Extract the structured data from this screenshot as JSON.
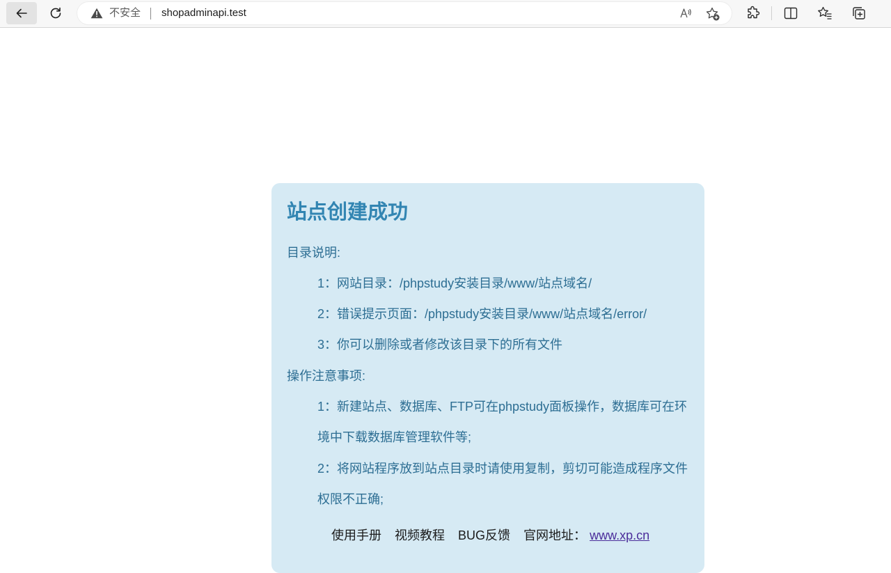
{
  "browser": {
    "insecure_label": "不安全",
    "url": "shopadminapi.test",
    "read_aloud_glyph": "A⁾"
  },
  "content": {
    "title": "站点创建成功",
    "dir_heading": "目录说明:",
    "dir_items": [
      "1：网站目录：/phpstudy安装目录/www/站点域名/",
      "2：错误提示页面：/phpstudy安装目录/www/站点域名/error/",
      "3：你可以删除或者修改该目录下的所有文件"
    ],
    "ops_heading": "操作注意事项:",
    "ops_items": [
      [
        "1：新建站点、数据库、FTP可在phpstudy面板操作，数据库可在环",
        "境中下载数据库管理软件等;"
      ],
      [
        "2：将网站程序放到站点目录时请使用复制，剪切可能造成程序文件",
        "权限不正确;"
      ]
    ],
    "footer": {
      "manual": "使用手册",
      "video": "视频教程",
      "bug": "BUG反馈",
      "site_label": "官网地址：",
      "site_link": "www.xp.cn"
    }
  },
  "colors": {
    "box_bg": "#d6eaf4",
    "title": "#3285b2",
    "text": "#2d6e93",
    "link": "#4b2d9a"
  }
}
